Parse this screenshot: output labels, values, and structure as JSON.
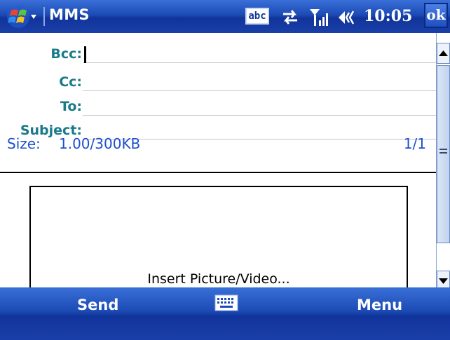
{
  "status_bar": {
    "app_title": "MMS",
    "input_mode": "abc",
    "clock": "10:05",
    "ok_label": "ok",
    "icons": [
      "windows-start-icon",
      "abc-input-icon",
      "sync-icon",
      "signal-icon",
      "speaker-icon"
    ]
  },
  "form": {
    "fields": [
      {
        "label": "Bcc:",
        "value": ""
      },
      {
        "label": "Cc:",
        "value": ""
      },
      {
        "label": "To:",
        "value": ""
      },
      {
        "label": "Subject:",
        "value": ""
      }
    ],
    "size_label": "Size:",
    "size_value": "1.00/300KB",
    "page_count": "1/1"
  },
  "slide": {
    "prompt": "Insert Picture/Video..."
  },
  "softkeys": {
    "left": "Send",
    "right": "Menu",
    "center_icon": "keyboard-icon"
  },
  "colors": {
    "title_bar": "#1c4bb5",
    "label": "#1a7a8a",
    "size_text": "#1f4fd0"
  }
}
